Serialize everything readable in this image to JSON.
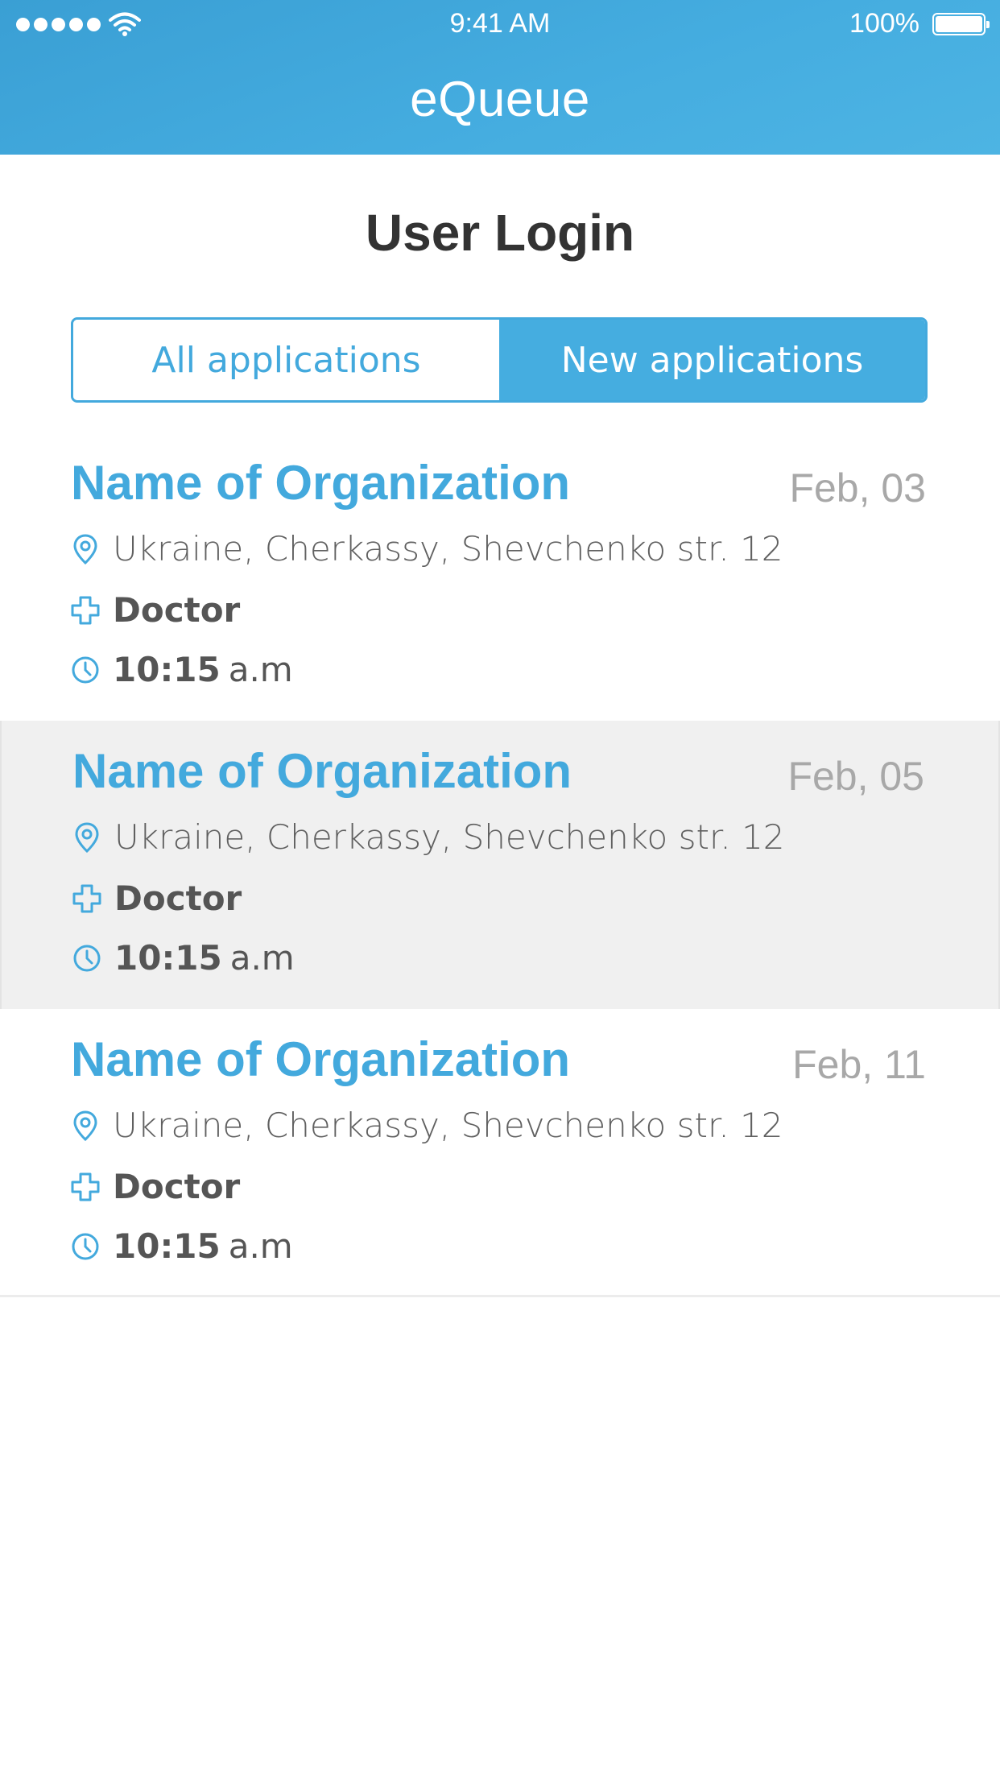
{
  "status_bar": {
    "time": "9:41 AM",
    "battery": "100%",
    "signal_icon": "signal-dots-icon",
    "wifi_icon": "wifi-icon",
    "battery_icon": "battery-icon"
  },
  "header": {
    "title": "eQueue",
    "color": "#45ade0"
  },
  "page": {
    "title": "User Login"
  },
  "tabs": [
    {
      "label": "All applications",
      "selected": false
    },
    {
      "label": "New applications",
      "selected": true
    }
  ],
  "applications": [
    {
      "org": "Name of Organization",
      "date": "Feb, 03",
      "address": "Ukraine, Cherkassy, Shevchenko str. 12",
      "specialist": "Doctor",
      "time": "10:15",
      "period": "a.m"
    },
    {
      "org": "Name of Organization",
      "date": "Feb, 05",
      "address": "Ukraine, Cherkassy, Shevchenko str. 12",
      "specialist": "Doctor",
      "time": "10:15",
      "period": "a.m"
    },
    {
      "org": "Name of Organization",
      "date": "Feb, 11",
      "address": "Ukraine, Cherkassy, Shevchenko str. 12",
      "specialist": "Doctor",
      "time": "10:15",
      "period": "a.m"
    }
  ],
  "icons": {
    "address": "location-pin-icon",
    "specialist": "medical-cross-icon",
    "time": "clock-icon"
  },
  "colors": {
    "accent": "#43a9dd",
    "selected_row": "#f0f0f0",
    "date": "#a8a8a8"
  }
}
